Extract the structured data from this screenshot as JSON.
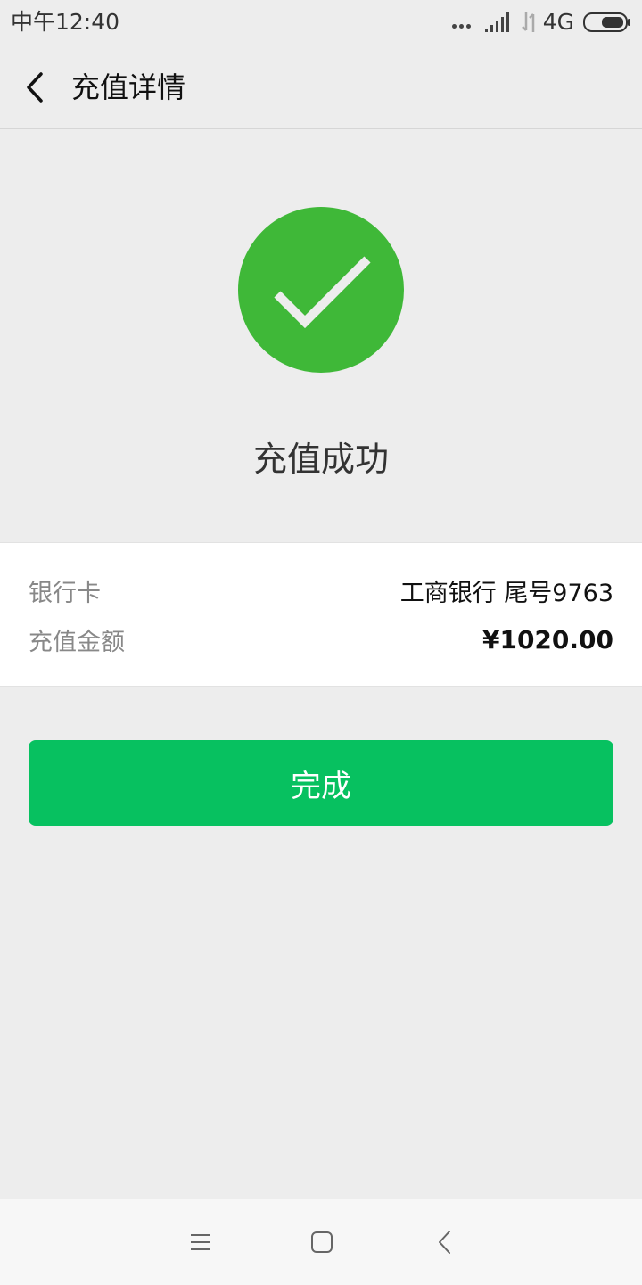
{
  "status_bar": {
    "time": "中午12:40",
    "network": "4G",
    "icons": [
      "more-dots-icon",
      "signal-icon",
      "data-arrows-icon",
      "battery-icon"
    ]
  },
  "header": {
    "back_icon": "chevron-left-icon",
    "title": "充值详情"
  },
  "result": {
    "icon": "check-circle-icon",
    "icon_color": "#3fb838",
    "message": "充值成功"
  },
  "details": {
    "rows": [
      {
        "label": "银行卡",
        "value": "工商银行 尾号9763"
      },
      {
        "label": "充值金额",
        "value": "¥1020.00"
      }
    ]
  },
  "actions": {
    "done_label": "完成",
    "done_color": "#07c160"
  },
  "nav": {
    "icons": [
      "menu-icon",
      "home-icon",
      "back-icon"
    ]
  }
}
